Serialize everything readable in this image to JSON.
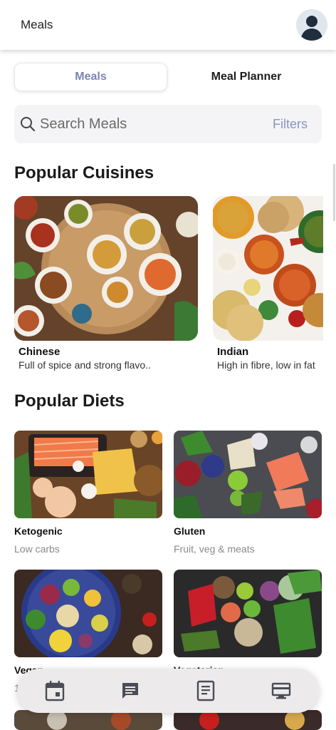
{
  "header": {
    "title": "Meals",
    "avatar_icon": "user-avatar-icon"
  },
  "tabs": {
    "meals": "Meals",
    "planner": "Meal Planner"
  },
  "search": {
    "placeholder": "Search Meals",
    "filters_label": "Filters"
  },
  "cuisines": {
    "title": "Popular Cuisines",
    "items": [
      {
        "name": "Chinese",
        "desc": "Full of spice and strong flavo.."
      },
      {
        "name": "Indian",
        "desc": "High in fibre, low in fat"
      }
    ]
  },
  "diets": {
    "title": "Popular Diets",
    "items": [
      {
        "name": "Ketogenic",
        "desc": "Low carbs"
      },
      {
        "name": "Gluten",
        "desc": "Fruit, veg & meats"
      },
      {
        "name": "Vegan",
        "desc": "1"
      },
      {
        "name": "Vegetarian",
        "desc": ""
      }
    ]
  },
  "nav": {
    "icons": [
      "calendar-icon",
      "chat-icon",
      "document-icon",
      "card-icon"
    ]
  },
  "colors": {
    "accent": "#7b84b3",
    "filters": "#8c93be",
    "search_bg": "#f4f4f6",
    "nav_bg": "#eceaea"
  }
}
